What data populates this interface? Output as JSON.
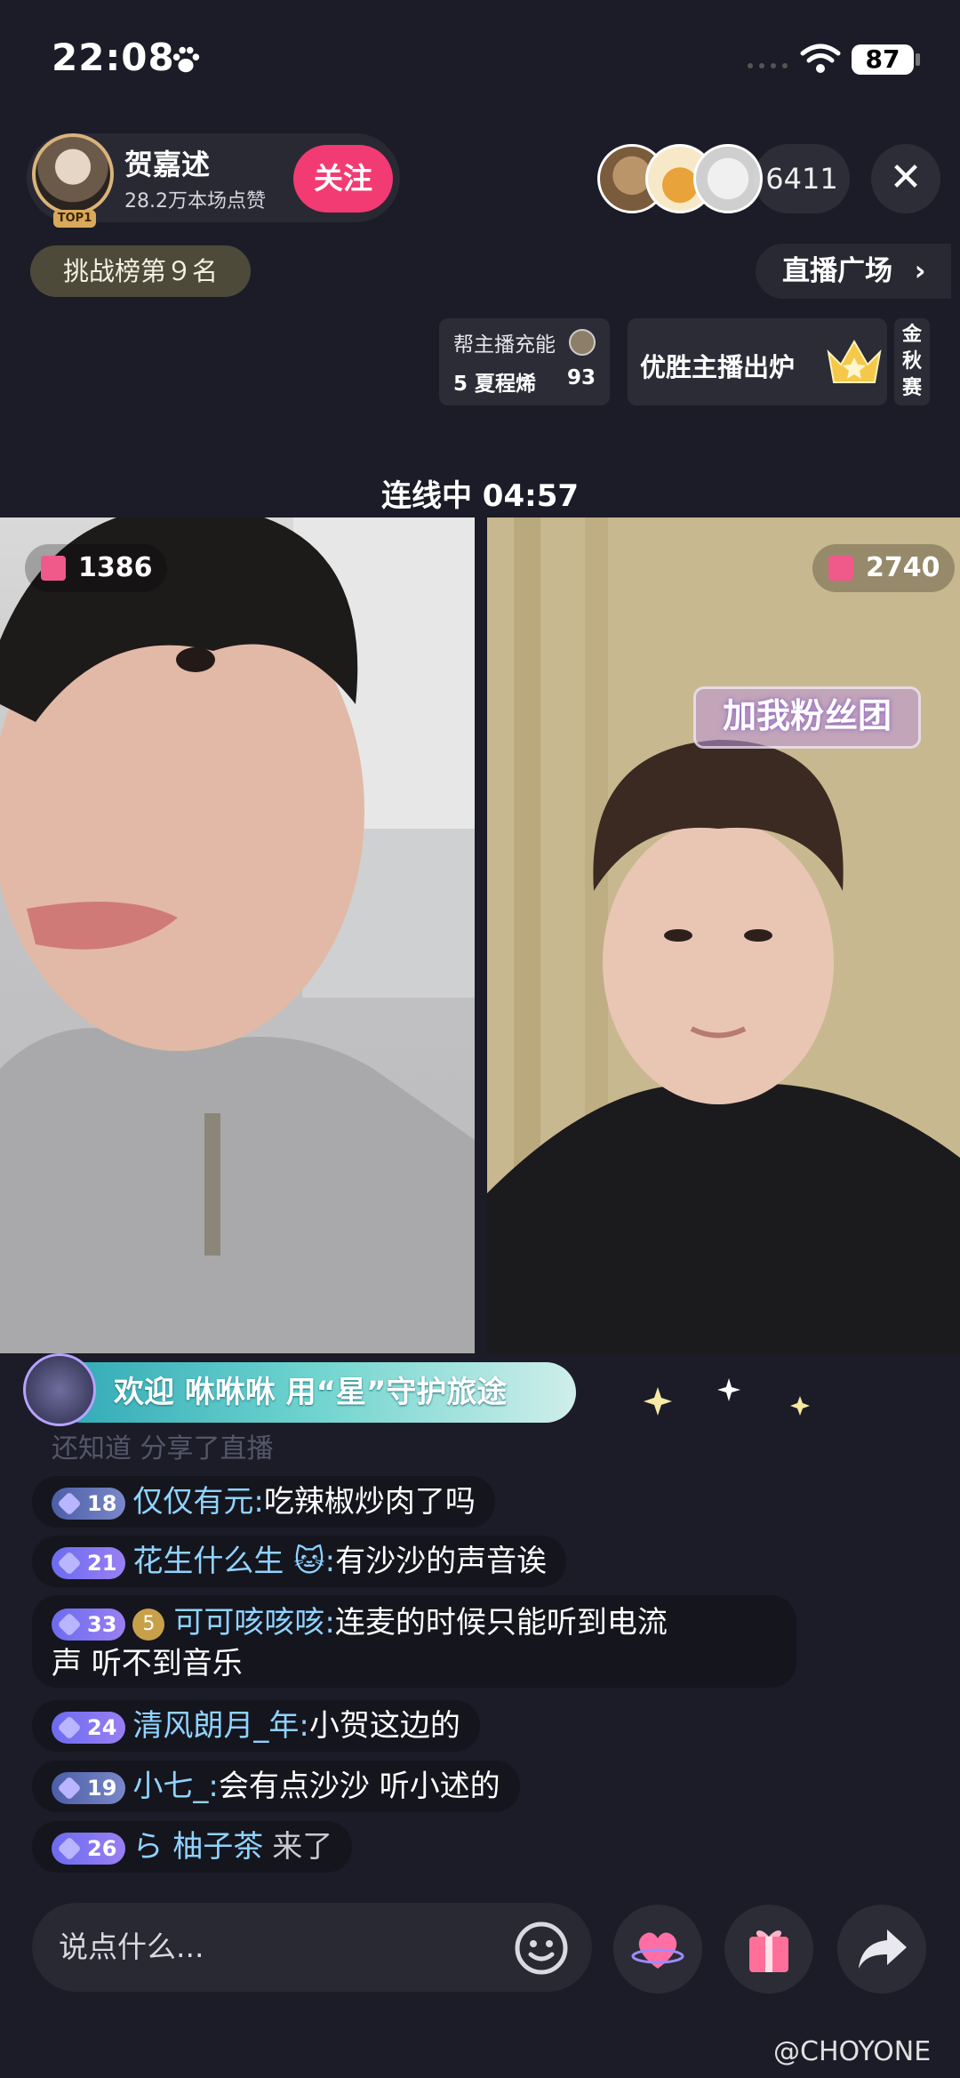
{
  "status_bar": {
    "time": "22:08",
    "battery": "87"
  },
  "host": {
    "name": "贺嘉述",
    "likes": "28.2万本场点赞",
    "badge": "TOP1",
    "follow_label": "关注"
  },
  "viewers": {
    "count": "6411"
  },
  "close_label": "✕",
  "rank": "挑战榜第９名",
  "plaza": "直播广场",
  "charge": {
    "title": "帮主播充能",
    "user": "5 夏程烯",
    "value": "93"
  },
  "winner": {
    "text": "优胜主播出炉"
  },
  "gold": "金秋赛",
  "pk_status": "连线中 04:57",
  "left_video": {
    "gifts": "1386"
  },
  "right_video": {
    "gifts": "2740",
    "banner": "加我粉丝团"
  },
  "welcome": "欢迎 咻咻咻 用“星”守护旅途",
  "faded_line": "还知道 分享了直播",
  "chat": [
    {
      "level": "18",
      "user": "仅仅有元:",
      "message": "吃辣椒炒肉了吗"
    },
    {
      "level": "21",
      "user": "花生什么生 🐱:",
      "message": "有沙沙的声音诶"
    },
    {
      "level": "33",
      "badge2": "5",
      "user": "可可咳咳咳:",
      "message": "连麦的时候只能听到电流",
      "message2": "声 听不到音乐"
    },
    {
      "level": "24",
      "user": "清风朗月_年:",
      "message": "小贺这边的"
    },
    {
      "level": "19",
      "user": "小七_:",
      "message": "会有点沙沙 听小述的"
    },
    {
      "level": "26",
      "user": "ら 柚子茶",
      "message": "来了"
    }
  ],
  "input": {
    "placeholder": "说点什么..."
  },
  "watermark": "@CHOYONE",
  "colors": {
    "background": "#1b1c27",
    "follow": "#f23b73",
    "username": "#8fd3ff"
  }
}
